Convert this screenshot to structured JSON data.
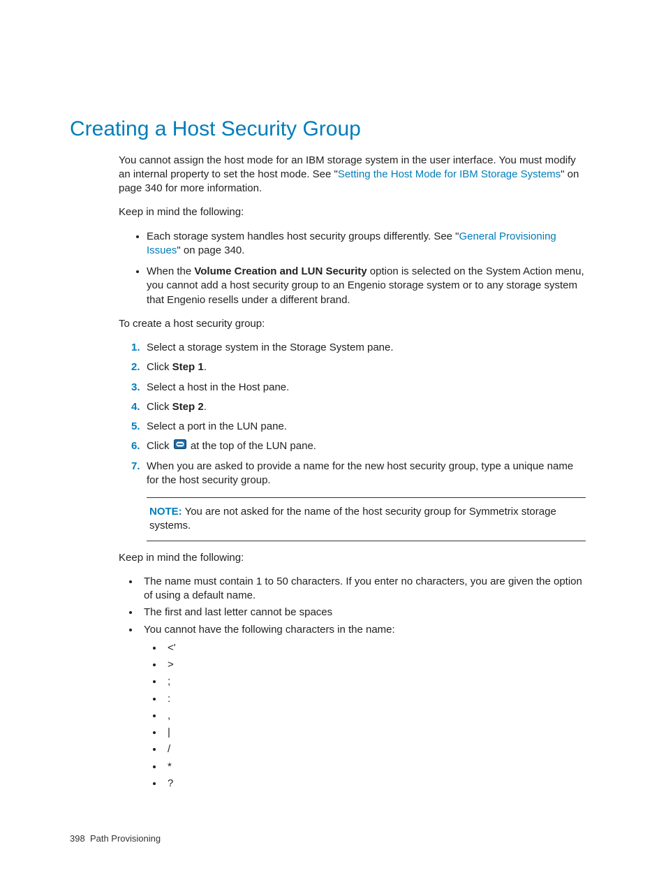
{
  "heading": "Creating a Host Security Group",
  "intro": {
    "pre": "You cannot assign the host mode for an IBM storage system in the user interface. You must modify an internal property to set the host mode. See \"",
    "link": "Setting the Host Mode for IBM Storage Systems",
    "post": "\" on page 340 for more information."
  },
  "keep_in_mind_1": "Keep in mind the following:",
  "bullets1": {
    "a": {
      "pre": "Each storage system handles host security groups differently. See \"",
      "link": "General Provisioning Issues",
      "post": "\" on page 340."
    },
    "b": {
      "pre": "When the ",
      "bold": "Volume Creation and LUN Security",
      "post": " option is selected on the System Action menu, you cannot add a host security group to an Engenio storage system or to any storage system that Engenio resells under a different brand."
    }
  },
  "to_create": "To create a host security group:",
  "steps": {
    "s1": {
      "num": "1.",
      "text": "Select a storage system in the Storage System pane."
    },
    "s2": {
      "num": "2.",
      "pre": "Click ",
      "bold": "Step 1",
      "post": "."
    },
    "s3": {
      "num": "3.",
      "text": "Select a host in the Host pane."
    },
    "s4": {
      "num": "4.",
      "pre": "Click ",
      "bold": "Step 2",
      "post": "."
    },
    "s5": {
      "num": "5.",
      "text": "Select a port in the LUN pane."
    },
    "s6": {
      "num": "6.",
      "pre": "Click ",
      "post": " at the top of the LUN pane."
    },
    "s7": {
      "num": "7.",
      "text": "When you are asked to provide a name for the new host security group, type a unique name for the host security group."
    }
  },
  "note": {
    "label": "NOTE:",
    "text": " You are not asked for the name of the host security group for Symmetrix storage systems."
  },
  "keep_in_mind_2": "Keep in mind the following:",
  "rules": {
    "r1": "The name must contain 1 to 50 characters. If you enter no characters, you are given the option of using a default name.",
    "r2": "The first and last letter cannot be spaces",
    "r3": "You cannot have the following characters in the name:"
  },
  "chars": {
    "c1": "<'",
    "c2": ">",
    "c3": ";",
    "c4": ":",
    "c5": ",",
    "c6": "|",
    "c7": "/",
    "c8": "*",
    "c9": "?"
  },
  "footer": {
    "page": "398",
    "section": "Path Provisioning"
  }
}
